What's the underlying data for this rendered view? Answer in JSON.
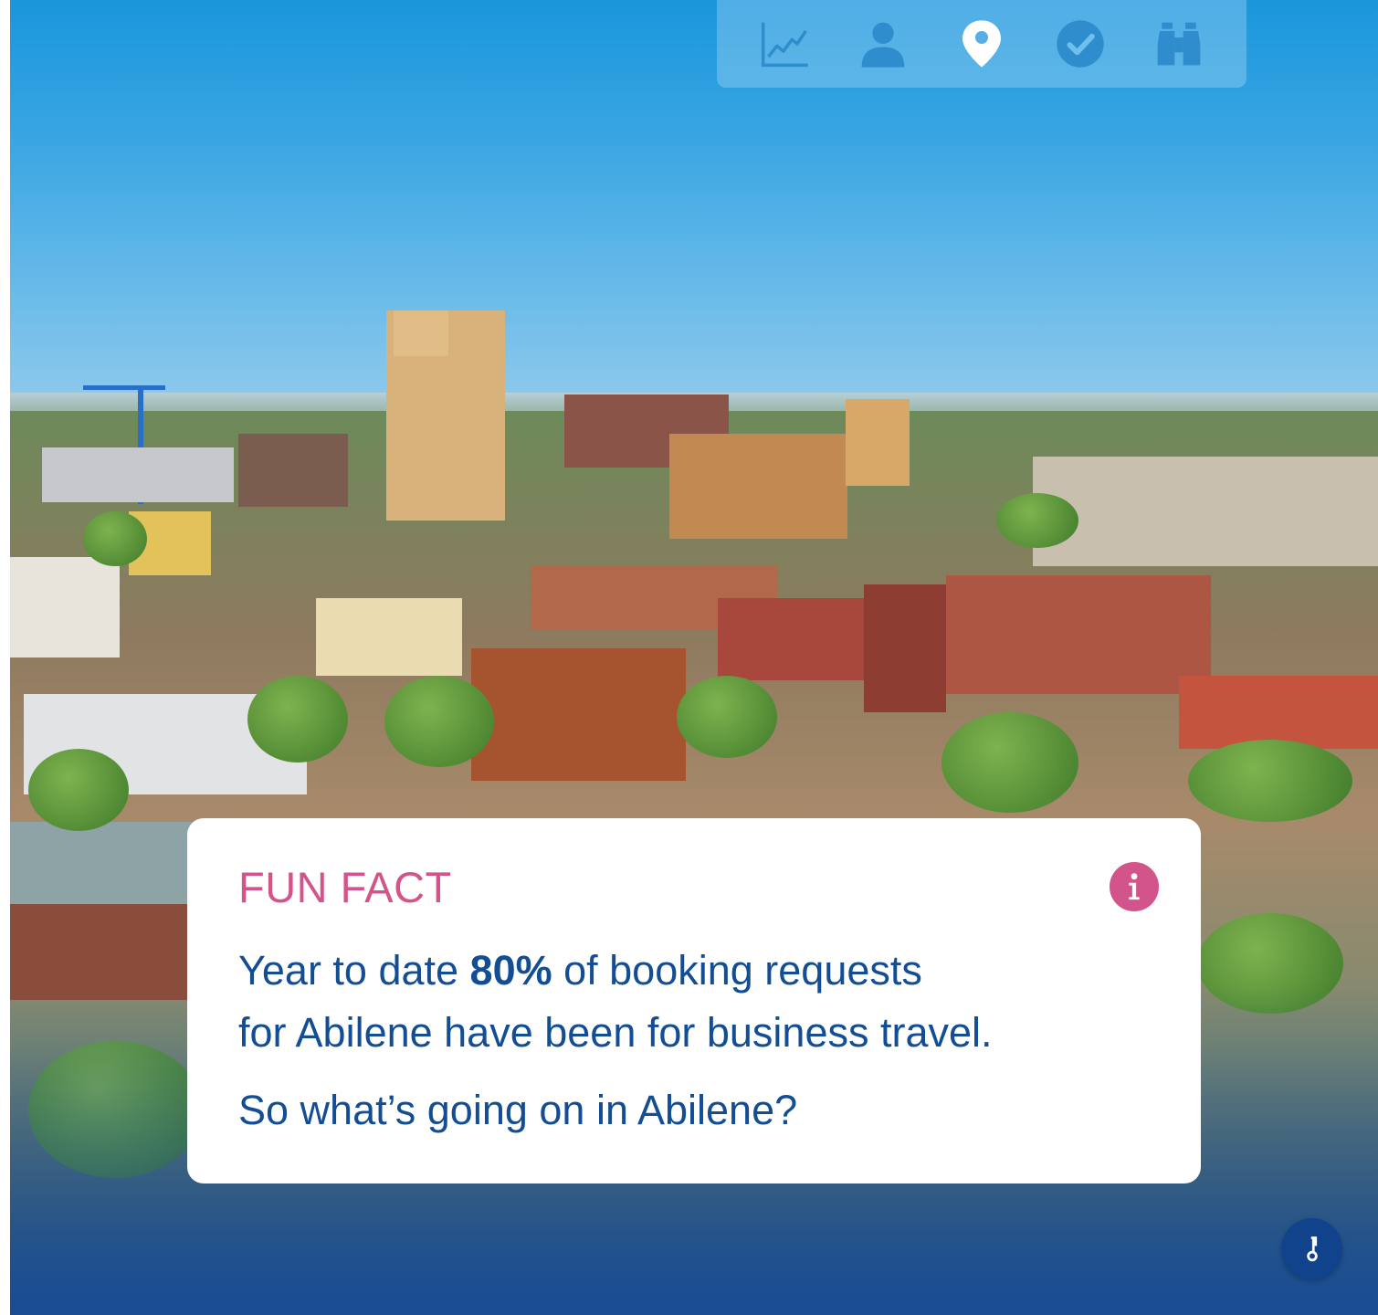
{
  "toolbar": {
    "icons": [
      "chart-line-icon",
      "person-icon",
      "map-pin-icon",
      "check-circle-icon",
      "binoculars-icon"
    ],
    "active_color": "#ffffff",
    "inactive_color": "#2f8ccd"
  },
  "card": {
    "title": "FUN FACT",
    "fact_prefix": "Year to date ",
    "fact_highlight": "80%",
    "fact_line1_suffix": " of booking requests",
    "fact_line2": "for Abilene have been for business travel.",
    "question": "So what’s going on in Abilene?",
    "title_color": "#d2548a",
    "text_color": "#134e95"
  },
  "floating_button": {
    "icon": "key-icon",
    "color": "#11438d"
  }
}
